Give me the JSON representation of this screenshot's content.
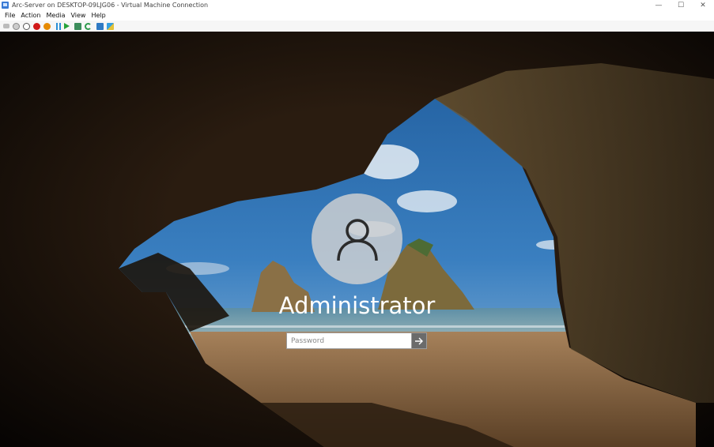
{
  "window": {
    "title": "Arc-Server on DESKTOP-09LJG06 - Virtual Machine Connection",
    "minimize_glyph": "—",
    "maximize_glyph": "☐",
    "close_glyph": "✕"
  },
  "menu": {
    "items": [
      "File",
      "Action",
      "Media",
      "View",
      "Help"
    ]
  },
  "toolbar": {
    "icons": [
      "back-icon",
      "ctrl-alt-del-icon",
      "stop-icon",
      "turn-off-icon",
      "shutdown-icon",
      "save-icon",
      "pause-icon",
      "start-icon",
      "checkpoint-icon",
      "revert-icon",
      "enhanced-session-icon",
      "share-icon"
    ]
  },
  "lock_screen": {
    "username": "Administrator",
    "password_placeholder": "Password",
    "submit_icon": "arrow-right-icon",
    "avatar_icon": "user-icon"
  },
  "colors": {
    "sky": "#2b6fb0",
    "cave": "#1a1208",
    "sand": "#7a5a3a"
  }
}
